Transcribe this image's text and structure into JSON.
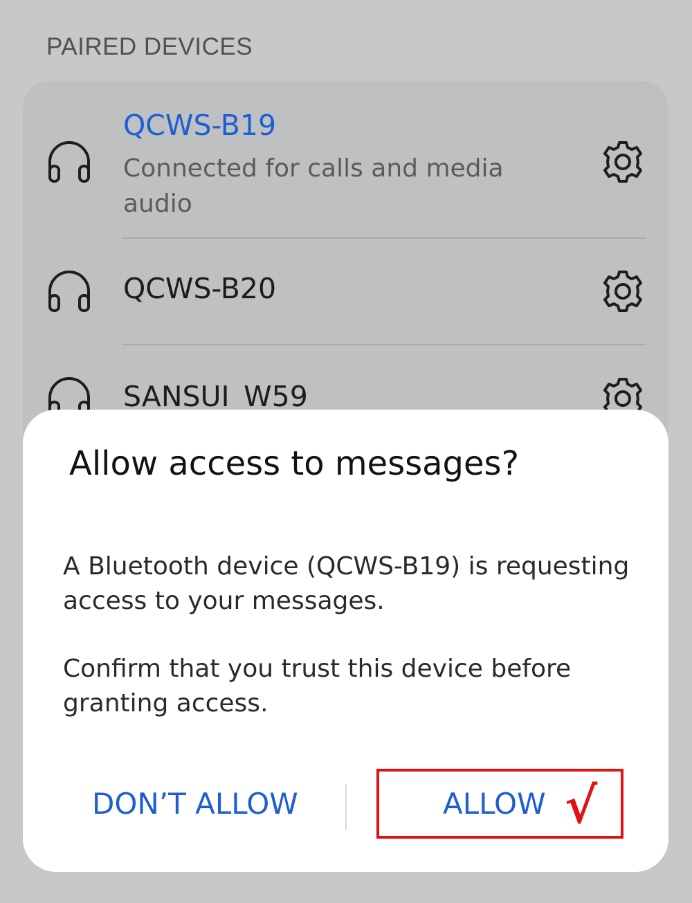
{
  "paired_devices": {
    "header": "PAIRED DEVICES",
    "devices": [
      {
        "name": "QCWS-B19",
        "status_line1": "Connected for calls and media",
        "status_line2": "audio",
        "icon": "headphones-icon",
        "connected": true
      },
      {
        "name": "QCWS-B20",
        "icon": "headphones-icon",
        "connected": false
      },
      {
        "name": "SANSUI_W59",
        "icon": "headphones-icon",
        "connected": false
      }
    ],
    "settings_icon": "gear-icon"
  },
  "dialog": {
    "title": "Allow access to messages?",
    "body_1_line1": "A Bluetooth device (QCWS-B19) is requesting",
    "body_1_line2": "access to your messages.",
    "body_2_line1": "Confirm that you trust this device before",
    "body_2_line2": "granting access.",
    "deny_label": "DON’T ALLOW",
    "allow_label": "ALLOW",
    "annotation_mark": "√"
  },
  "colors": {
    "accent": "#1d5ed3",
    "annotation": "#e01212",
    "background": "#c8c8c9",
    "dialog": "#ffffff"
  }
}
